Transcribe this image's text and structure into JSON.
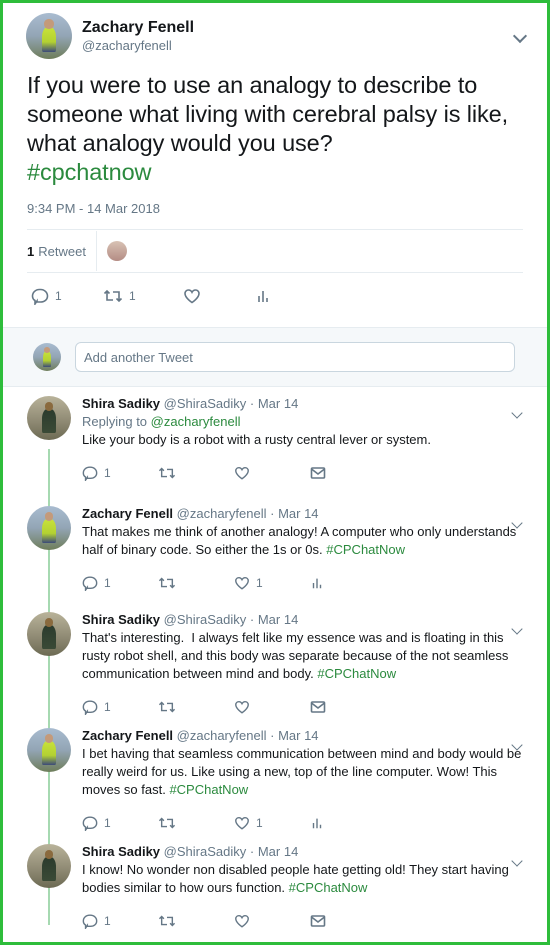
{
  "tweet": {
    "author_name": "Zachary Fenell",
    "author_handle": "@zacharyfenell",
    "text_main": "If you were to use an analogy to describe to someone what living with cerebral palsy is like, what analogy would you use?",
    "hashtag": "#cpchatnow",
    "timestamp": "9:34 PM - 14 Mar 2018",
    "retweet_count": "1",
    "retweet_label": "Retweet",
    "reply_count": "1",
    "retweets_action_count": "1"
  },
  "compose": {
    "placeholder": "Add another Tweet"
  },
  "replies": [
    {
      "name": "Shira Sadiky",
      "handle": "@ShiraSadiky",
      "dot": "·",
      "date": "Mar 14",
      "replying_prefix": "Replying to",
      "replying_to": "@zacharyfenell",
      "text": "Like your body is a robot with a rusty central lever or system.",
      "hashtag": "",
      "reply_count": "1",
      "retweet_count": "",
      "like_count": ""
    },
    {
      "name": "Zachary Fenell",
      "handle": "@zacharyfenell",
      "dot": "·",
      "date": "Mar 14",
      "text": "That makes me think of another analogy! A computer who only understands half of binary code. So either the 1s or 0s.",
      "hashtag": "#CPChatNow",
      "reply_count": "1",
      "retweet_count": "",
      "like_count": "1"
    },
    {
      "name": "Shira Sadiky",
      "handle": "@ShiraSadiky",
      "dot": "·",
      "date": "Mar 14",
      "text": "That's interesting.  I always felt like my essence was and is floating in this rusty robot shell, and this body was separate because of the not seamless communication between mind and body.",
      "hashtag": "#CPChatNow",
      "reply_count": "1",
      "retweet_count": "",
      "like_count": ""
    },
    {
      "name": "Zachary Fenell",
      "handle": "@zacharyfenell",
      "dot": "·",
      "date": "Mar 14",
      "text": "I bet having that seamless communication between mind and body would be really weird for us. Like using a new, top of the line computer. Wow! This moves so fast.",
      "hashtag": "#CPChatNow",
      "reply_count": "1",
      "retweet_count": "",
      "like_count": "1"
    },
    {
      "name": "Shira Sadiky",
      "handle": "@ShiraSadiky",
      "dot": "·",
      "date": "Mar 14",
      "text": "I know! No wonder non disabled people hate getting old! They start having bodies similar to how ours function.",
      "hashtag": "#CPChatNow",
      "reply_count": "1",
      "retweet_count": "",
      "like_count": ""
    }
  ],
  "colors": {
    "frame": "#2ebd3b",
    "hashtag": "#2b8a3e",
    "thread_line": "#a6d9b1"
  },
  "icons": [
    "reply-icon",
    "retweet-icon",
    "like-icon",
    "analytics-icon",
    "message-icon",
    "chevron-down-icon"
  ]
}
